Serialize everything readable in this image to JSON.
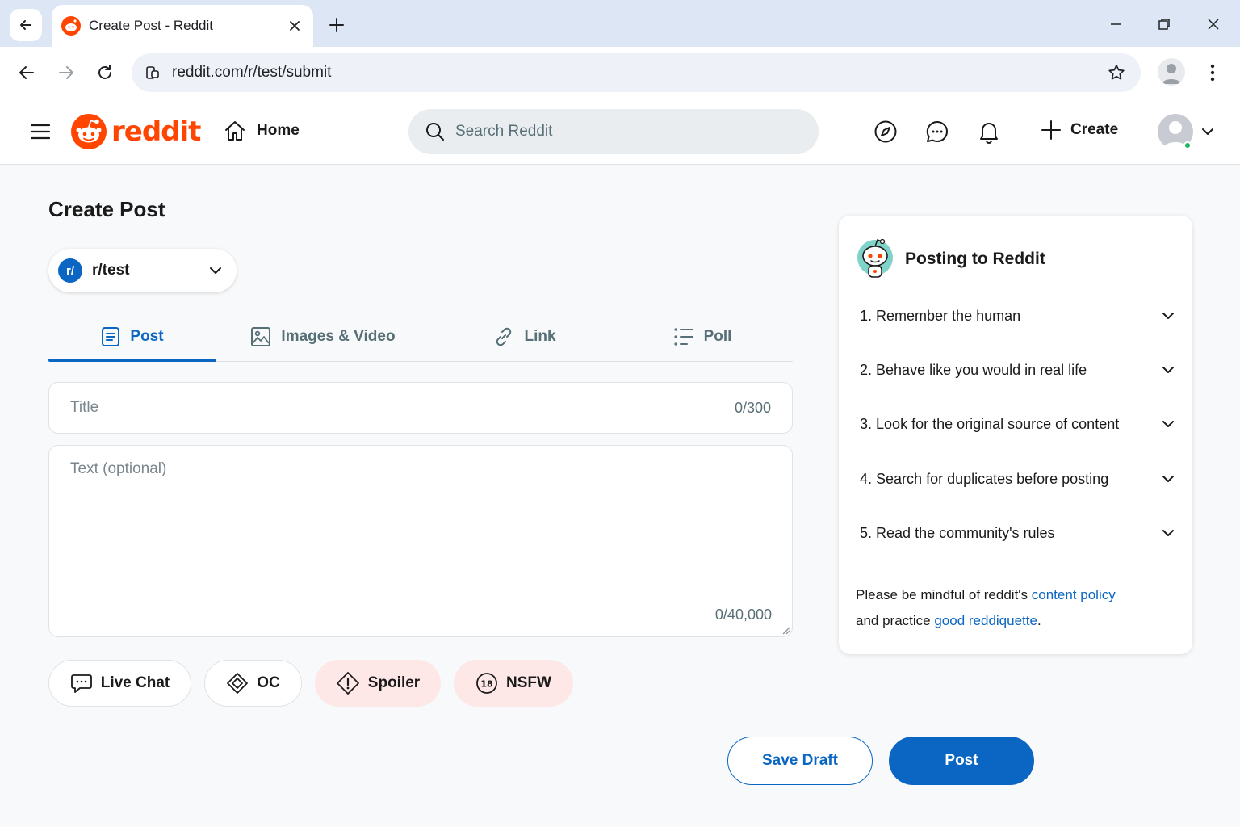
{
  "browser": {
    "tab_title": "Create Post - Reddit",
    "url": "reddit.com/r/test/submit"
  },
  "header": {
    "logo_text": "reddit",
    "home_label": "Home",
    "search_placeholder": "Search Reddit",
    "create_label": "Create"
  },
  "main": {
    "page_title": "Create Post",
    "community": {
      "badge": "r/",
      "name": "r/test"
    },
    "tabs": [
      {
        "label": "Post",
        "icon": "document-icon",
        "active": true
      },
      {
        "label": "Images & Video",
        "icon": "image-icon",
        "active": false
      },
      {
        "label": "Link",
        "icon": "link-icon",
        "active": false
      },
      {
        "label": "Poll",
        "icon": "poll-icon",
        "active": false
      }
    ],
    "title_field": {
      "placeholder": "Title",
      "counter": "0/300"
    },
    "body_field": {
      "placeholder": "Text (optional)",
      "counter": "0/40,000"
    },
    "chips": [
      {
        "label": "Live Chat",
        "icon": "chat-bubble-icon"
      },
      {
        "label": "OC",
        "icon": "oc-diamond-icon"
      },
      {
        "label": "Spoiler",
        "icon": "alert-icon"
      },
      {
        "label": "NSFW",
        "icon": "18-badge-icon"
      }
    ],
    "save_draft_label": "Save Draft",
    "post_label": "Post"
  },
  "sidebar": {
    "title": "Posting to Reddit",
    "rules": [
      {
        "number": "1.",
        "text": "Remember the human"
      },
      {
        "number": "2.",
        "text": "Behave like you would in real life"
      },
      {
        "number": "3.",
        "text": "Look for the original source of content"
      },
      {
        "number": "4.",
        "text": "Search for duplicates before posting"
      },
      {
        "number": "5.",
        "text": "Read the community's rules"
      }
    ],
    "note_prefix": "Please be mindful of reddit's ",
    "note_link1": "content policy",
    "note_middle": "and practice ",
    "note_link2": "good reddiquette",
    "note_suffix": "."
  },
  "colors": {
    "accent": "#0a66c2",
    "brand": "#ff4500",
    "chip_pink": "#fde7e7"
  }
}
